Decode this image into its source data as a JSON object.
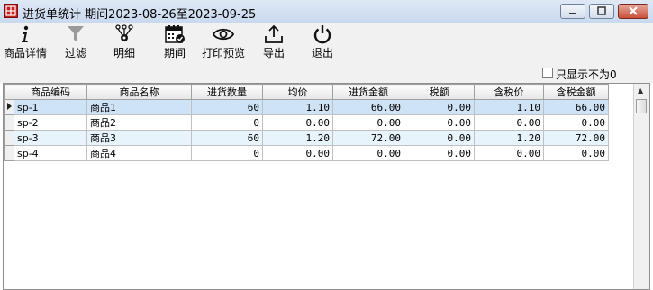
{
  "window": {
    "title": "进货单统计 期间2023-08-26至2023-09-25"
  },
  "toolbar": {
    "items": [
      {
        "label": "商品详情",
        "icon": "info-icon"
      },
      {
        "label": "过滤",
        "icon": "filter-icon"
      },
      {
        "label": "明细",
        "icon": "detail-icon"
      },
      {
        "label": "期间",
        "icon": "calendar-icon"
      },
      {
        "label": "打印预览",
        "icon": "eye-icon"
      },
      {
        "label": "导出",
        "icon": "export-icon"
      },
      {
        "label": "退出",
        "icon": "power-icon"
      }
    ]
  },
  "filter": {
    "show_nonzero_label": "只显示不为0",
    "show_nonzero_checked": false
  },
  "grid": {
    "columns": [
      "商品编码",
      "商品名称",
      "进货数量",
      "均价",
      "进货金额",
      "税额",
      "含税价",
      "含税金额"
    ],
    "rows": [
      {
        "code": "sp-1",
        "name": "商品1",
        "qty": "60",
        "avg": "1.10",
        "amount": "66.00",
        "tax": "0.00",
        "tax_price": "1.10",
        "tax_amount": "66.00"
      },
      {
        "code": "sp-2",
        "name": "商品2",
        "qty": "0",
        "avg": "0.00",
        "amount": "0.00",
        "tax": "0.00",
        "tax_price": "0.00",
        "tax_amount": "0.00"
      },
      {
        "code": "sp-3",
        "name": "商品3",
        "qty": "60",
        "avg": "1.20",
        "amount": "72.00",
        "tax": "0.00",
        "tax_price": "1.20",
        "tax_amount": "72.00"
      },
      {
        "code": "sp-4",
        "name": "商品4",
        "qty": "0",
        "avg": "0.00",
        "amount": "0.00",
        "tax": "0.00",
        "tax_price": "0.00",
        "tax_amount": "0.00"
      }
    ]
  },
  "colors": {
    "app_icon": "#c8201e",
    "selected_row": "#cfe3f7",
    "alt_row": "#e8f4fb"
  }
}
